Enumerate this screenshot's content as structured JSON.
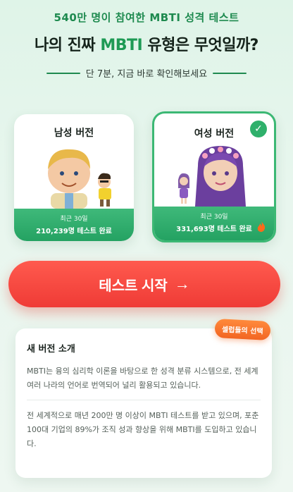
{
  "header": {
    "sub": "540만 명이 참여한 MBTI 성격 테스트",
    "headline_before": "나의 진짜 ",
    "headline_accent": "MBTI",
    "headline_after": " 유형은 무엇일까?",
    "tagline": "단 7분, 지금 바로 확인해보세요"
  },
  "versions": [
    {
      "title": "남성 버전",
      "period": "최근 30일",
      "stat": "210,239명 테스트 완료",
      "selected": false
    },
    {
      "title": "여성 버전",
      "period": "최근 30일",
      "stat": "331,693명 테스트 완료",
      "selected": true
    }
  ],
  "start_button": {
    "label": "테스트 시작",
    "arrow": "→"
  },
  "info": {
    "badge": "셀럽들의 선택",
    "title": "새 버전 소개",
    "paragraph1": "MBTI는 융의 심리학 이론을 바탕으로 한 성격 분류 시스템으로, 전 세계 여러 나라의 언어로 번역되어 널리 활용되고 있습니다.",
    "paragraph2": "전 세계적으로 매년 200만 명 이상이 MBTI 테스트를 받고 있으며, 포춘 100대 기업의 89%가 조직 성과 향상을 위해 MBTI를 도입하고 있습니다."
  },
  "icons": {
    "check": "check-icon",
    "fire": "fire-icon",
    "arrow": "arrow-right-icon"
  },
  "colors": {
    "accent": "#1e9a55",
    "start": "#ef3b36",
    "badge": "#f26522"
  }
}
